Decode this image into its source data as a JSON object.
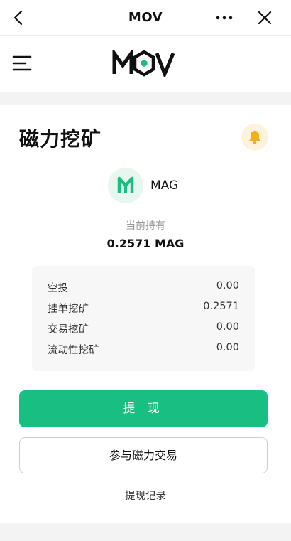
{
  "topbar": {
    "title": "MOV",
    "back_icon": "chevron-left-icon",
    "more_icon": "more-horizontal-icon",
    "close_icon": "close-icon"
  },
  "appbar": {
    "menu_icon": "hamburger-menu-icon",
    "logo_text": "MOV"
  },
  "mining": {
    "title": "磁力挖矿",
    "bell_icon": "bell-icon",
    "token": {
      "name": "MAG",
      "icon": "mag-token-icon"
    },
    "holding_label": "当前持有",
    "holding_value": "0.2571 MAG",
    "details": [
      {
        "label": "空投",
        "value": "0.00"
      },
      {
        "label": "挂单挖矿",
        "value": "0.2571"
      },
      {
        "label": "交易挖矿",
        "value": "0.00"
      },
      {
        "label": "流动性挖矿",
        "value": "0.00"
      }
    ],
    "withdraw_button": "提 现",
    "trade_button": "参与磁力交易",
    "withdraw_record_link": "提现记录"
  },
  "colors": {
    "accent": "#19bf82",
    "bell": "#f2b01e",
    "bell_bg": "#fdf3dc"
  }
}
